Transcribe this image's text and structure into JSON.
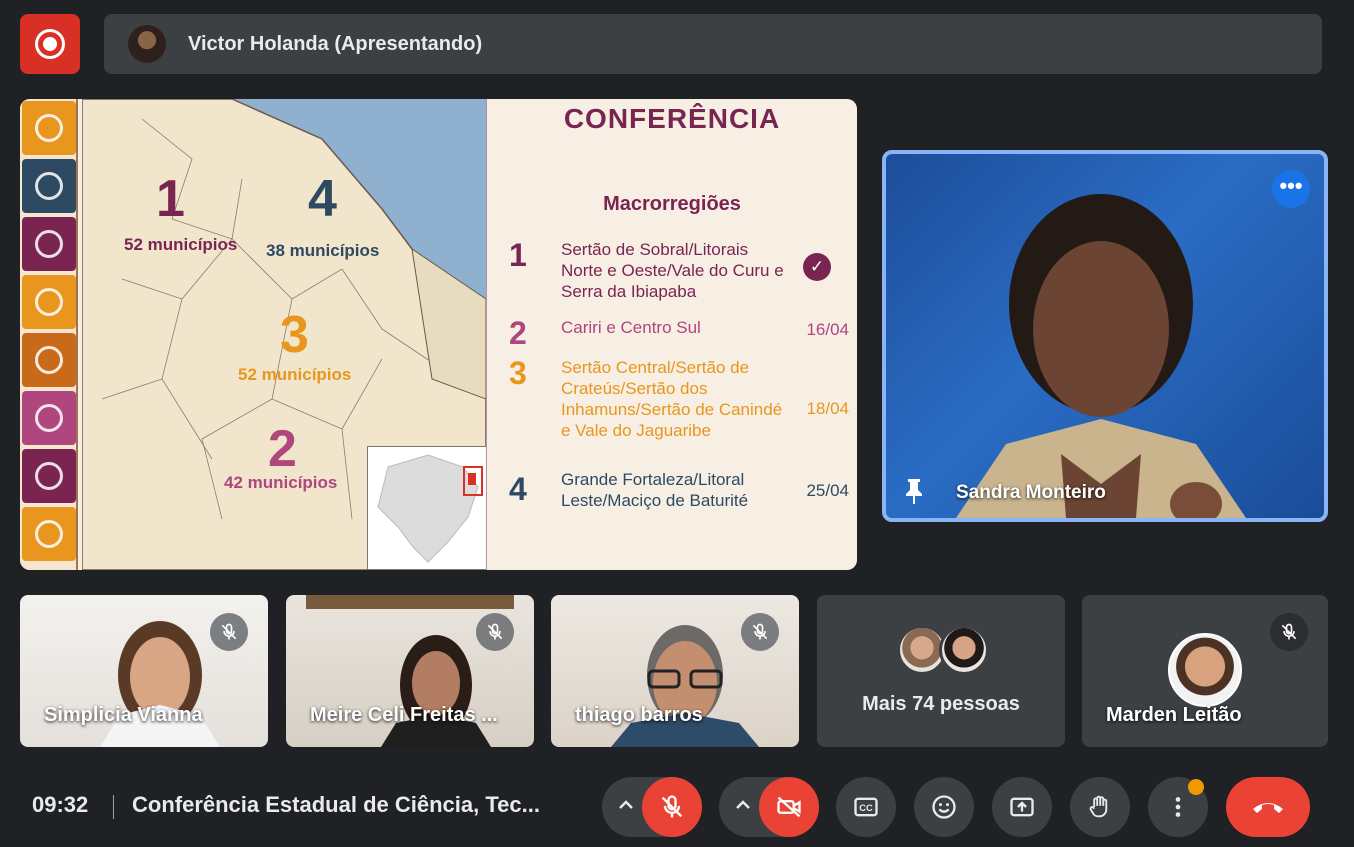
{
  "presenter": {
    "name": "Victor Holanda (Apresentando)"
  },
  "slide": {
    "title": "CONFERÊNCIA",
    "subtitle": "Macrorregiões",
    "map_regions": [
      {
        "num": "1",
        "count": "52 municípios",
        "color": "#7a2452"
      },
      {
        "num": "4",
        "count": "38 municípios",
        "color": "#2e4a62"
      },
      {
        "num": "3",
        "count": "52 municípios",
        "color": "#e8961e"
      },
      {
        "num": "2",
        "count": "42 municípios",
        "color": "#b0467e"
      }
    ],
    "macroregions": [
      {
        "num": "1",
        "name": "Sertão de Sobral/Litorais Norte e Oeste/Vale do Curu e Serra da Ibiapaba",
        "date": "",
        "color": "#7a2452",
        "done": true
      },
      {
        "num": "2",
        "name": "Cariri e Centro Sul",
        "date": "16/04",
        "color": "#b0467e",
        "done": false
      },
      {
        "num": "3",
        "name": "Sertão Central/Sertão de Crateús/Sertão dos Inhamuns/Sertão de Canindé e Vale do Jaguaribe",
        "date": "18/04",
        "color": "#e8961e",
        "done": false
      },
      {
        "num": "4",
        "name": "Grande Fortaleza/Litoral Leste/Maciço de Baturité",
        "date": "25/04",
        "color": "#2e4a62",
        "done": false
      }
    ]
  },
  "main_participant": {
    "name": "Sandra Monteiro"
  },
  "participants": [
    {
      "name": "Simplicia Vianna",
      "muted": true
    },
    {
      "name": "Meire Celi Freitas ...",
      "muted": true
    },
    {
      "name": "thiago barros",
      "muted": true
    },
    {
      "name": "Marden Leitão",
      "muted": true
    }
  ],
  "more_people": {
    "label": "Mais 74 pessoas"
  },
  "bottom_bar": {
    "time": "09:32",
    "meeting_title": "Conferência Estadual de Ciência, Tec..."
  },
  "colors": {
    "accent_blue": "#8ab4f8",
    "danger_red": "#ea4335",
    "surface": "#3c4043",
    "background": "#202124"
  },
  "icons": [
    "record-icon",
    "mic-off-icon",
    "camera-off-icon",
    "captions-icon",
    "emoji-icon",
    "present-icon",
    "raise-hand-icon",
    "more-options-icon",
    "hang-up-icon",
    "pin-icon"
  ]
}
